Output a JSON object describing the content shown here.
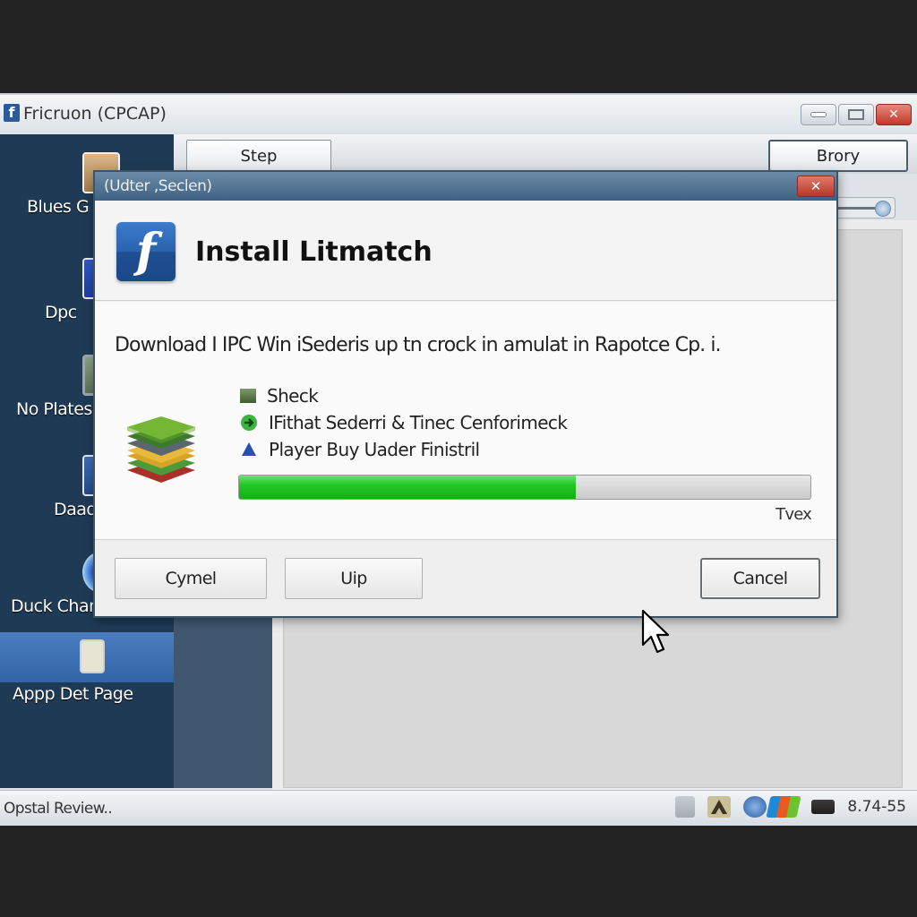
{
  "window": {
    "title": "Fricruon (CPCAP)",
    "app_icon": "facebook-f-icon",
    "controls": {
      "minimize": "minimize-icon",
      "maximize": "maximize-icon",
      "close": "close-icon",
      "close_glyph": "✕"
    }
  },
  "toolbar": {
    "step_label": "Step",
    "brory_label": "Brory"
  },
  "sidebar": {
    "items": [
      {
        "label": "Blues G",
        "icon": "avatar-photo-icon",
        "active": false
      },
      {
        "label": "Dpc",
        "icon": "grid-app-icon",
        "active": false
      },
      {
        "label": "No Plates",
        "icon": "monitor-icon",
        "active": false
      },
      {
        "label": "Daad",
        "icon": "document-person-icon",
        "active": false
      },
      {
        "label": "Duck Change",
        "icon": "blue-c-logo-icon",
        "active": false
      },
      {
        "label": "Appp Det Page",
        "icon": "clipboard-check-icon",
        "active": true
      }
    ]
  },
  "dialog": {
    "title": "(Udter ,Seclen)",
    "close_glyph": "✕",
    "heading": "Install  Litmatch",
    "logo_letter": "f",
    "description": "Download I IPC Win iSederis up tn crock in amulat in  Rapotce Cp. i.",
    "features": [
      {
        "icon": "green-square-icon",
        "label": "Sheck"
      },
      {
        "icon": "green-arrow-circle-icon",
        "label": "IFithat Sederri & Tinec Cenforimeck"
      },
      {
        "icon": "blue-triangle-icon",
        "label": "Player Buy Uader Finistril"
      }
    ],
    "progress": {
      "percent": 59,
      "label": "Tvex"
    },
    "buttons": {
      "button1": "Cymel",
      "button2": "Uip",
      "cancel": "Cancel"
    }
  },
  "statusbar": {
    "text": "Opstal Review..",
    "tray_icons": [
      "network-icon",
      "up-arrow-icon",
      "ie-icon",
      "color-flag-icon",
      "keyboard-icon"
    ],
    "time": "8.74-55"
  },
  "colors": {
    "sidebar_bg": "#1e3a55",
    "sidebar_active": "#3f72b4",
    "dialog_title_bg": "#4e7090",
    "progress_fill": "#22c422",
    "close_red": "#c73d2f"
  }
}
